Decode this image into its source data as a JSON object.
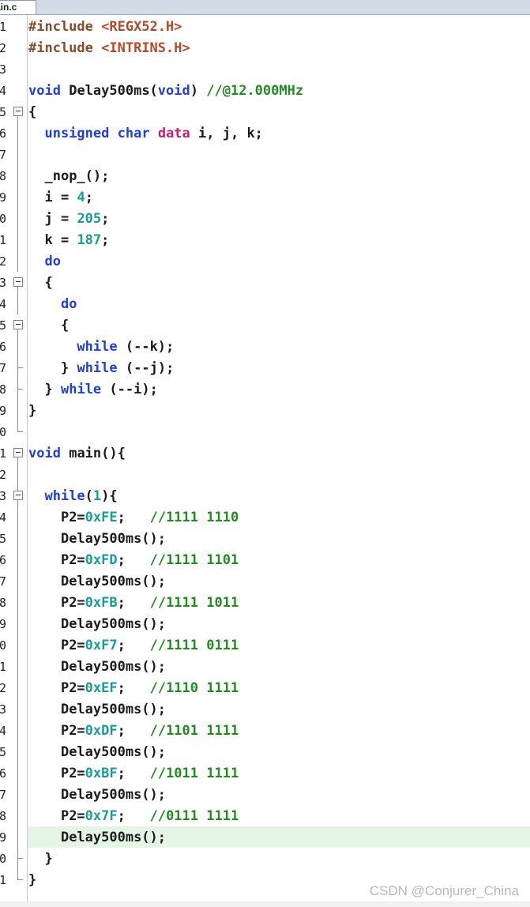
{
  "tab": {
    "label": "ain.c"
  },
  "line_numbers": [
    "1",
    "2",
    "3",
    "4",
    "5",
    "6",
    "7",
    "8",
    "9",
    "0",
    "1",
    "2",
    "3",
    "4",
    "5",
    "6",
    "7",
    "8",
    "9",
    "0",
    "1",
    "2",
    "3",
    "4",
    "5",
    "6",
    "7",
    "8",
    "9",
    "0",
    "1",
    "2",
    "3",
    "4",
    "5",
    "6",
    "7",
    "8",
    "9",
    "0",
    "1"
  ],
  "code": {
    "l1_directive": "#include",
    "l1_header": "<REGX52.H>",
    "l2_directive": "#include",
    "l2_header": "<INTRINS.H>",
    "l4_void": "void",
    "l4_name": "Delay500ms(",
    "l4_param": "void",
    "l4_close": ")",
    "l4_comment": "//@12.000MHz",
    "l5": "{",
    "l6_unsigned": "unsigned",
    "l6_char": "char",
    "l6_data": "data",
    "l6_vars": "i, j, k;",
    "l8": "_nop_();",
    "l9_prefix": "i = ",
    "l9_num": "4",
    "l10_prefix": "j = ",
    "l10_num": "205",
    "l11_prefix": "k = ",
    "l11_num": "187",
    "l12_do": "do",
    "l13": "{",
    "l14_do": "do",
    "l15": "{",
    "l16_while": "while",
    "l16_rest": "(--k);",
    "l17_brace": "}",
    "l17_while": "while",
    "l17_rest": "(--j);",
    "l18_brace": "}",
    "l18_while": "while",
    "l18_rest": "(--i);",
    "l19": "}",
    "l21_void": "void",
    "l21_rest": "main(){",
    "l23_while": "while",
    "l23_open": "(",
    "l23_num": "1",
    "l23_close": "){",
    "l39": "}",
    "l40": "}"
  },
  "port_lines": [
    {
      "assign": "P2=",
      "value": "0xFE",
      "comment": "//1111 1110"
    },
    {
      "assign": "P2=",
      "value": "0xFD",
      "comment": "//1111 1101"
    },
    {
      "assign": "P2=",
      "value": "0xFB",
      "comment": "//1111 1011"
    },
    {
      "assign": "P2=",
      "value": "0xF7",
      "comment": "//1111 0111"
    },
    {
      "assign": "P2=",
      "value": "0xEF",
      "comment": "//1110 1111"
    },
    {
      "assign": "P2=",
      "value": "0xDF",
      "comment": "//1101 1111"
    },
    {
      "assign": "P2=",
      "value": "0xBF",
      "comment": "//1011 1111"
    },
    {
      "assign": "P2=",
      "value": "0x7F",
      "comment": "//0111 1111"
    }
  ],
  "delay_call": "Delay500ms();",
  "semicolon": ";",
  "watermark": "CSDN @Conjurer_China",
  "colors": {
    "keyword": "#1f3fd6",
    "comment": "#228b22",
    "number": "#1a9a9a",
    "preprocessor": "#8b4a2a",
    "datatype_qualifier": "#c0206f",
    "current_line_highlight": "#e5f5e3"
  }
}
